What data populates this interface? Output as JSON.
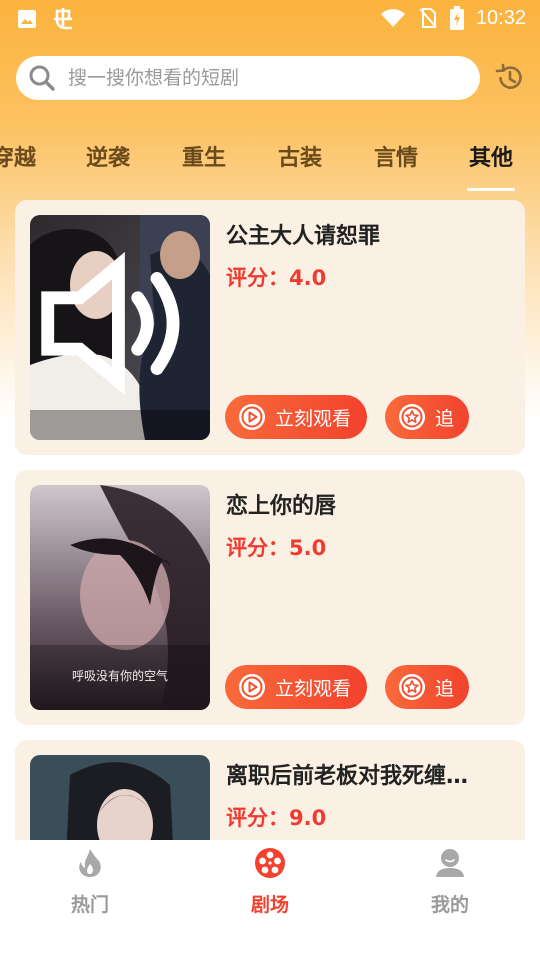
{
  "status_bar": {
    "time": "10:32"
  },
  "search": {
    "placeholder": "搜一搜你想看的短剧"
  },
  "tabs": [
    {
      "label": "穿越"
    },
    {
      "label": "逆袭"
    },
    {
      "label": "重生"
    },
    {
      "label": "古装"
    },
    {
      "label": "言情"
    },
    {
      "label": "其他",
      "active": true
    }
  ],
  "cards": [
    {
      "title": "公主大人请恕罪",
      "rating": "评分：4.0",
      "watch_label": "立刻观看",
      "follow_label": "追",
      "muted_icon": "speaker-icon"
    },
    {
      "title": "恋上你的唇",
      "rating": "评分：5.0",
      "watch_label": "立刻观看",
      "follow_label": "追",
      "subtitle": "呼吸没有你的空气"
    },
    {
      "title": "离职后前老板对我死缠…",
      "rating": "评分：9.0"
    }
  ],
  "bottom_nav": [
    {
      "label": "热门",
      "icon": "fire-icon"
    },
    {
      "label": "剧场",
      "icon": "film-reel-icon",
      "active": true
    },
    {
      "label": "我的",
      "icon": "user-icon"
    }
  ],
  "colors": {
    "accent": "#f2422e",
    "rating": "#ef3b30",
    "card_bg": "#faf0e4",
    "header_orange": "#fbb33d"
  }
}
